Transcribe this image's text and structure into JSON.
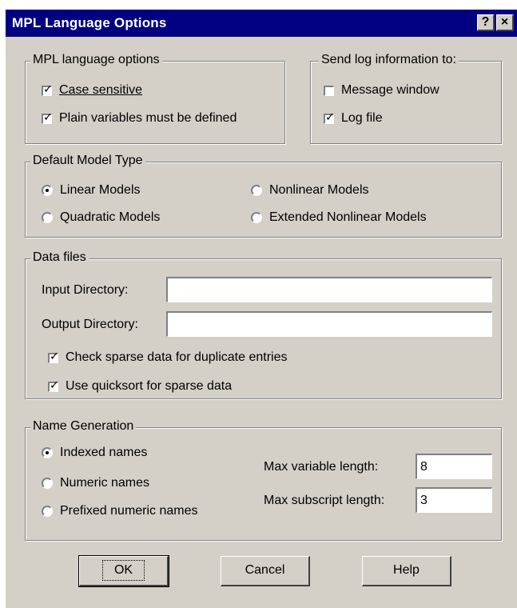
{
  "window": {
    "title": "MPL Language Options",
    "help_btn": "?",
    "close_btn": "×"
  },
  "mpl_options": {
    "legend": "MPL language options",
    "case_sensitive": {
      "label": "Case sensitive",
      "checked": true
    },
    "plain_vars": {
      "label": "Plain variables must be defined",
      "checked": true
    }
  },
  "log_info": {
    "legend": "Send log information to:",
    "message_window": {
      "label": "Message window",
      "checked": false
    },
    "log_file": {
      "label": "Log file",
      "checked": true
    }
  },
  "model_type": {
    "legend": "Default Model Type",
    "linear": "Linear Models",
    "nonlinear": "Nonlinear Models",
    "quadratic": "Quadratic Models",
    "extended": "Extended Nonlinear Models",
    "selected": "linear"
  },
  "data_files": {
    "legend": "Data files",
    "input_label": "Input Directory:",
    "input_value": "",
    "output_label": "Output Directory:",
    "output_value": "",
    "check_sparse": {
      "label": "Check sparse data for duplicate entries",
      "checked": true
    },
    "quicksort": {
      "label": "Use quicksort for sparse data",
      "checked": true
    }
  },
  "name_gen": {
    "legend": "Name Generation",
    "indexed": "Indexed names",
    "numeric": "Numeric names",
    "prefixed": "Prefixed numeric names",
    "selected": "indexed",
    "max_var_label": "Max variable length:",
    "max_var_value": "8",
    "max_sub_label": "Max subscript length:",
    "max_sub_value": "3"
  },
  "buttons": {
    "ok": "OK",
    "cancel": "Cancel",
    "help": "Help"
  }
}
